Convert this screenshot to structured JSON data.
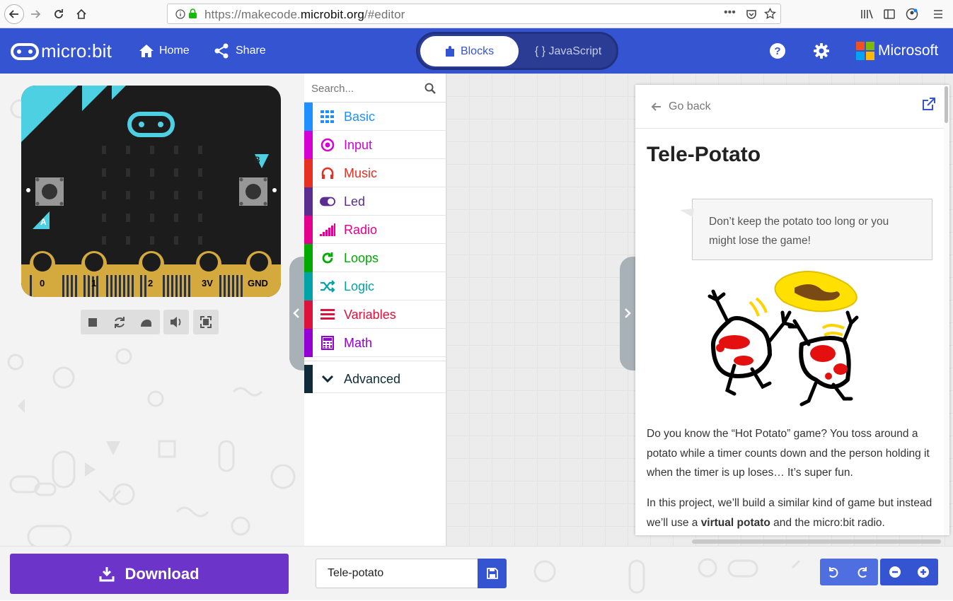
{
  "browser": {
    "url_prefix": "https://makecode.",
    "url_domain": "microbit.org",
    "url_suffix": "/#editor",
    "dots": "•••"
  },
  "header": {
    "logo": "micro:bit",
    "home_label": "Home",
    "share_label": "Share",
    "tab_blocks": "Blocks",
    "tab_js": "{ } JavaScript",
    "brand": "Microsoft",
    "color": "#3454d1"
  },
  "simulator": {
    "pins": [
      "0",
      "1",
      "2",
      "3V",
      "GND"
    ],
    "button_a": "A",
    "button_b": "B"
  },
  "toolbox": {
    "search_placeholder": "Search...",
    "categories": [
      {
        "label": "Basic",
        "color": "#1e90ff",
        "icon": "grid-icon"
      },
      {
        "label": "Input",
        "color": "#d400d4",
        "icon": "target-icon"
      },
      {
        "label": "Music",
        "color": "#e63022",
        "icon": "headphones-icon"
      },
      {
        "label": "Led",
        "color": "#5c2d91",
        "icon": "toggle-icon"
      },
      {
        "label": "Radio",
        "color": "#e3008c",
        "icon": "signal-icon"
      },
      {
        "label": "Loops",
        "color": "#00aa00",
        "icon": "refresh-icon"
      },
      {
        "label": "Logic",
        "color": "#00a4a6",
        "icon": "shuffle-icon"
      },
      {
        "label": "Variables",
        "color": "#dc143c",
        "icon": "lines-icon"
      },
      {
        "label": "Math",
        "color": "#9400d3",
        "icon": "calculator-icon"
      }
    ],
    "advanced": "Advanced"
  },
  "tutorial": {
    "go_back": "Go back",
    "title": "Tele-Potato",
    "callout": "Don’t keep the potato too long or you might lose the game!",
    "para1": "Do you know the “Hot Potato” game? You toss around a potato while a timer counts down and the person holding it when the timer is up loses… It’s super fun.",
    "para2_a": "In this project, we’ll build a similar kind of game but instead we’ll use a ",
    "para2_bold": "virtual potato",
    "para2_b": " and the micro:bit radio."
  },
  "footer": {
    "download_label": "Download",
    "project_name": "Tele-potato"
  }
}
